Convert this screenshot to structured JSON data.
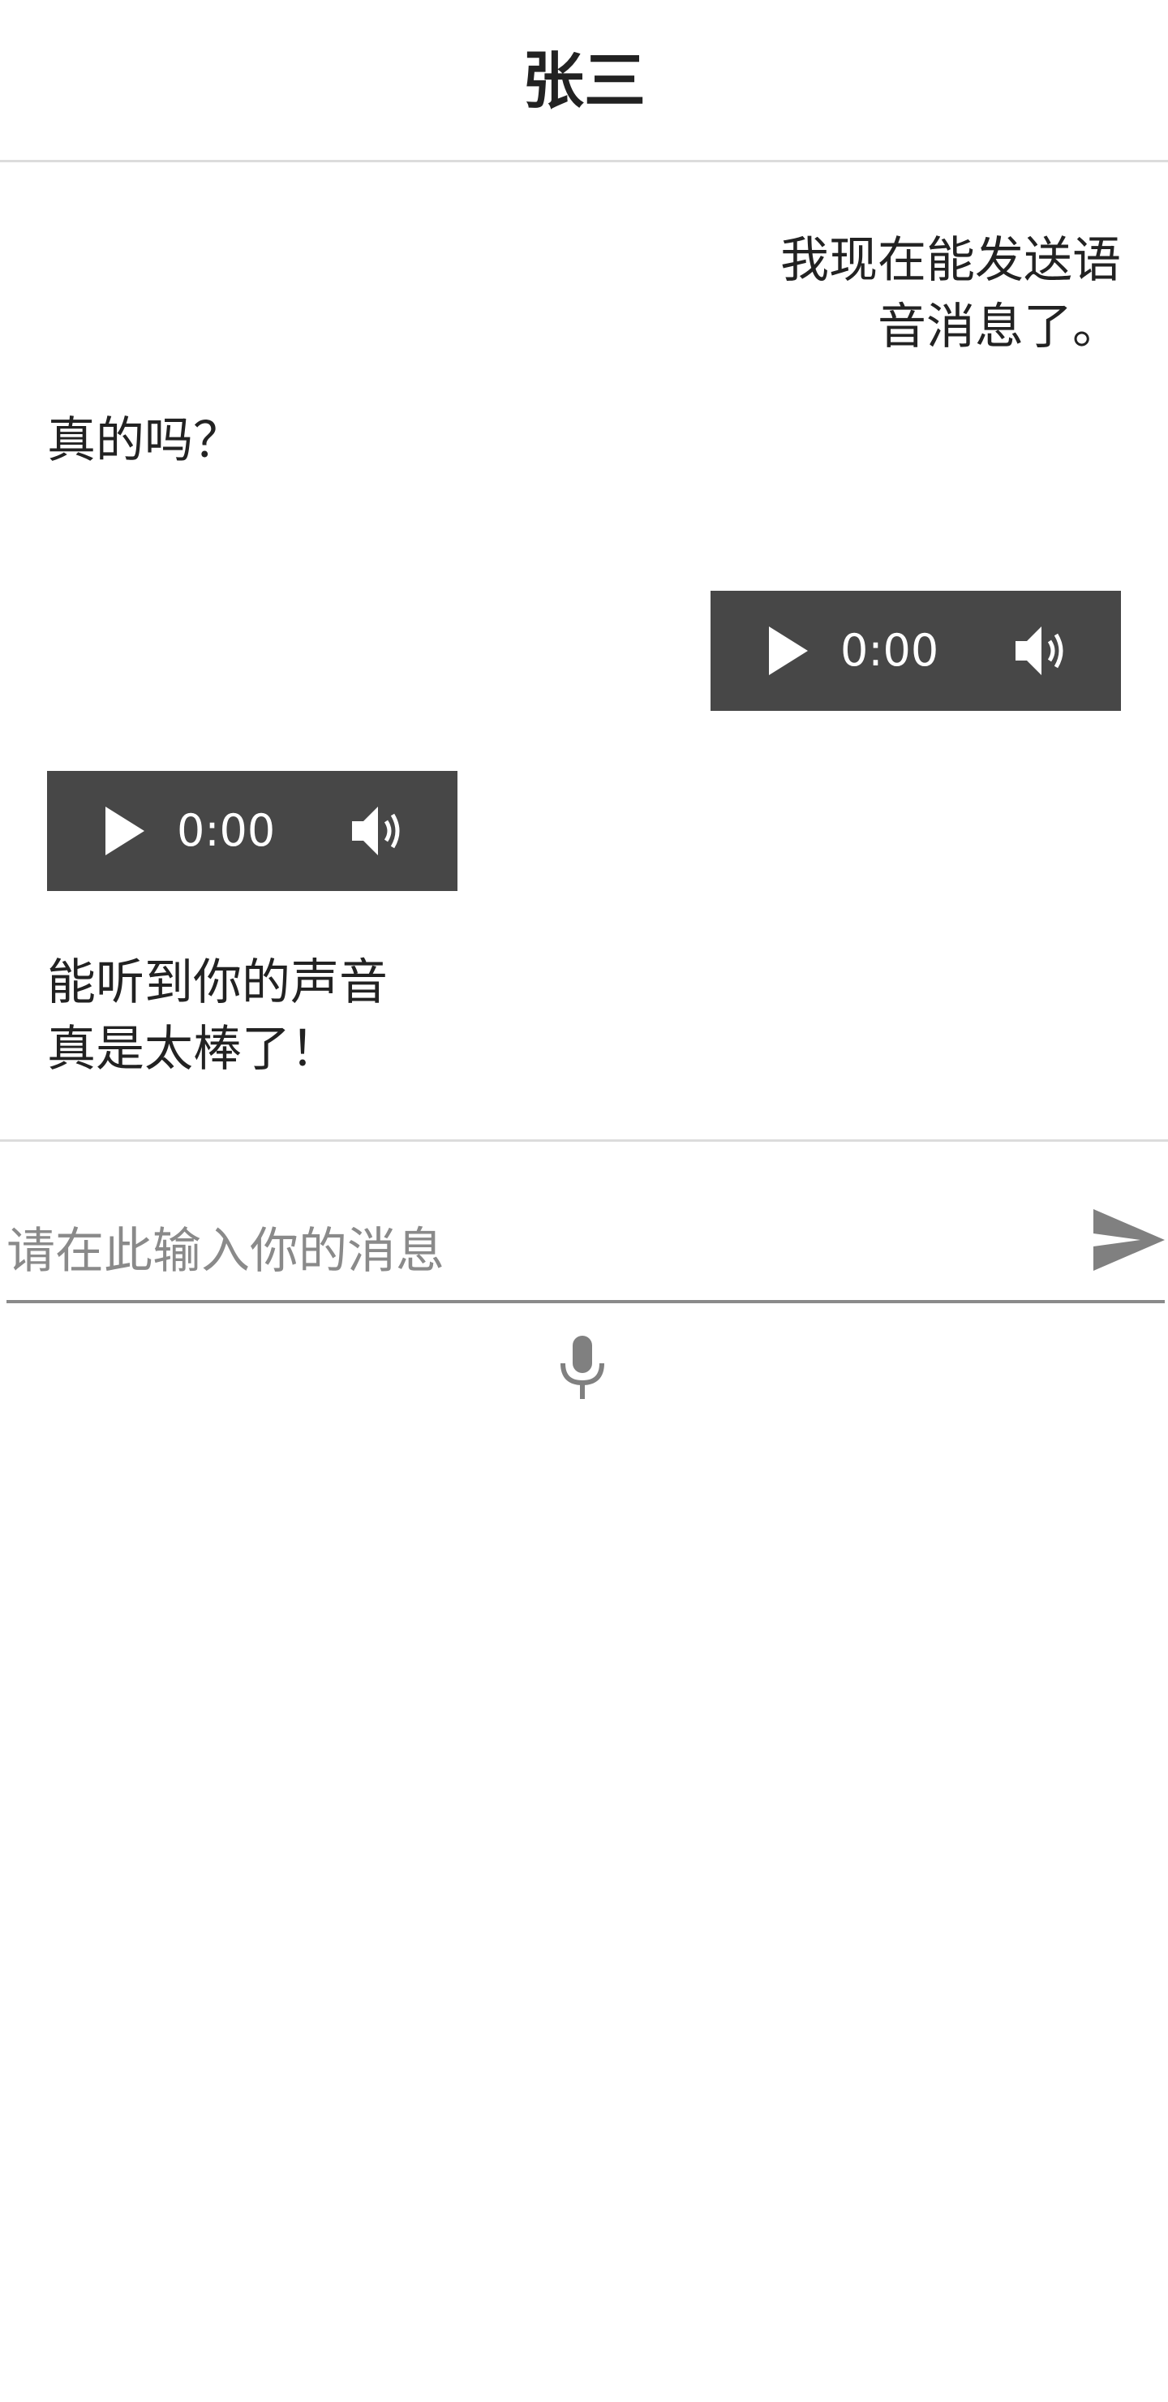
{
  "header": {
    "title": "张三"
  },
  "messages": [
    {
      "side": "right",
      "type": "text",
      "line1": "我现在能发送语",
      "line2": "音消息了。"
    },
    {
      "side": "left",
      "type": "text",
      "line1": "真的吗？"
    },
    {
      "side": "right",
      "type": "audio",
      "time": "0:00"
    },
    {
      "side": "left",
      "type": "audio",
      "time": "0:00"
    },
    {
      "side": "left",
      "type": "text",
      "line1": "能听到你的声音",
      "line2": "真是太棒了！"
    }
  ],
  "composer": {
    "placeholder": "请在此输入你的消息",
    "value": ""
  },
  "icons": {
    "play": "play-icon",
    "volume": "volume-icon",
    "send": "send-icon",
    "mic": "microphone-icon"
  },
  "colors": {
    "audio_bg": "#474747",
    "icon_gray": "#808080",
    "divider": "#dcdcdc"
  }
}
